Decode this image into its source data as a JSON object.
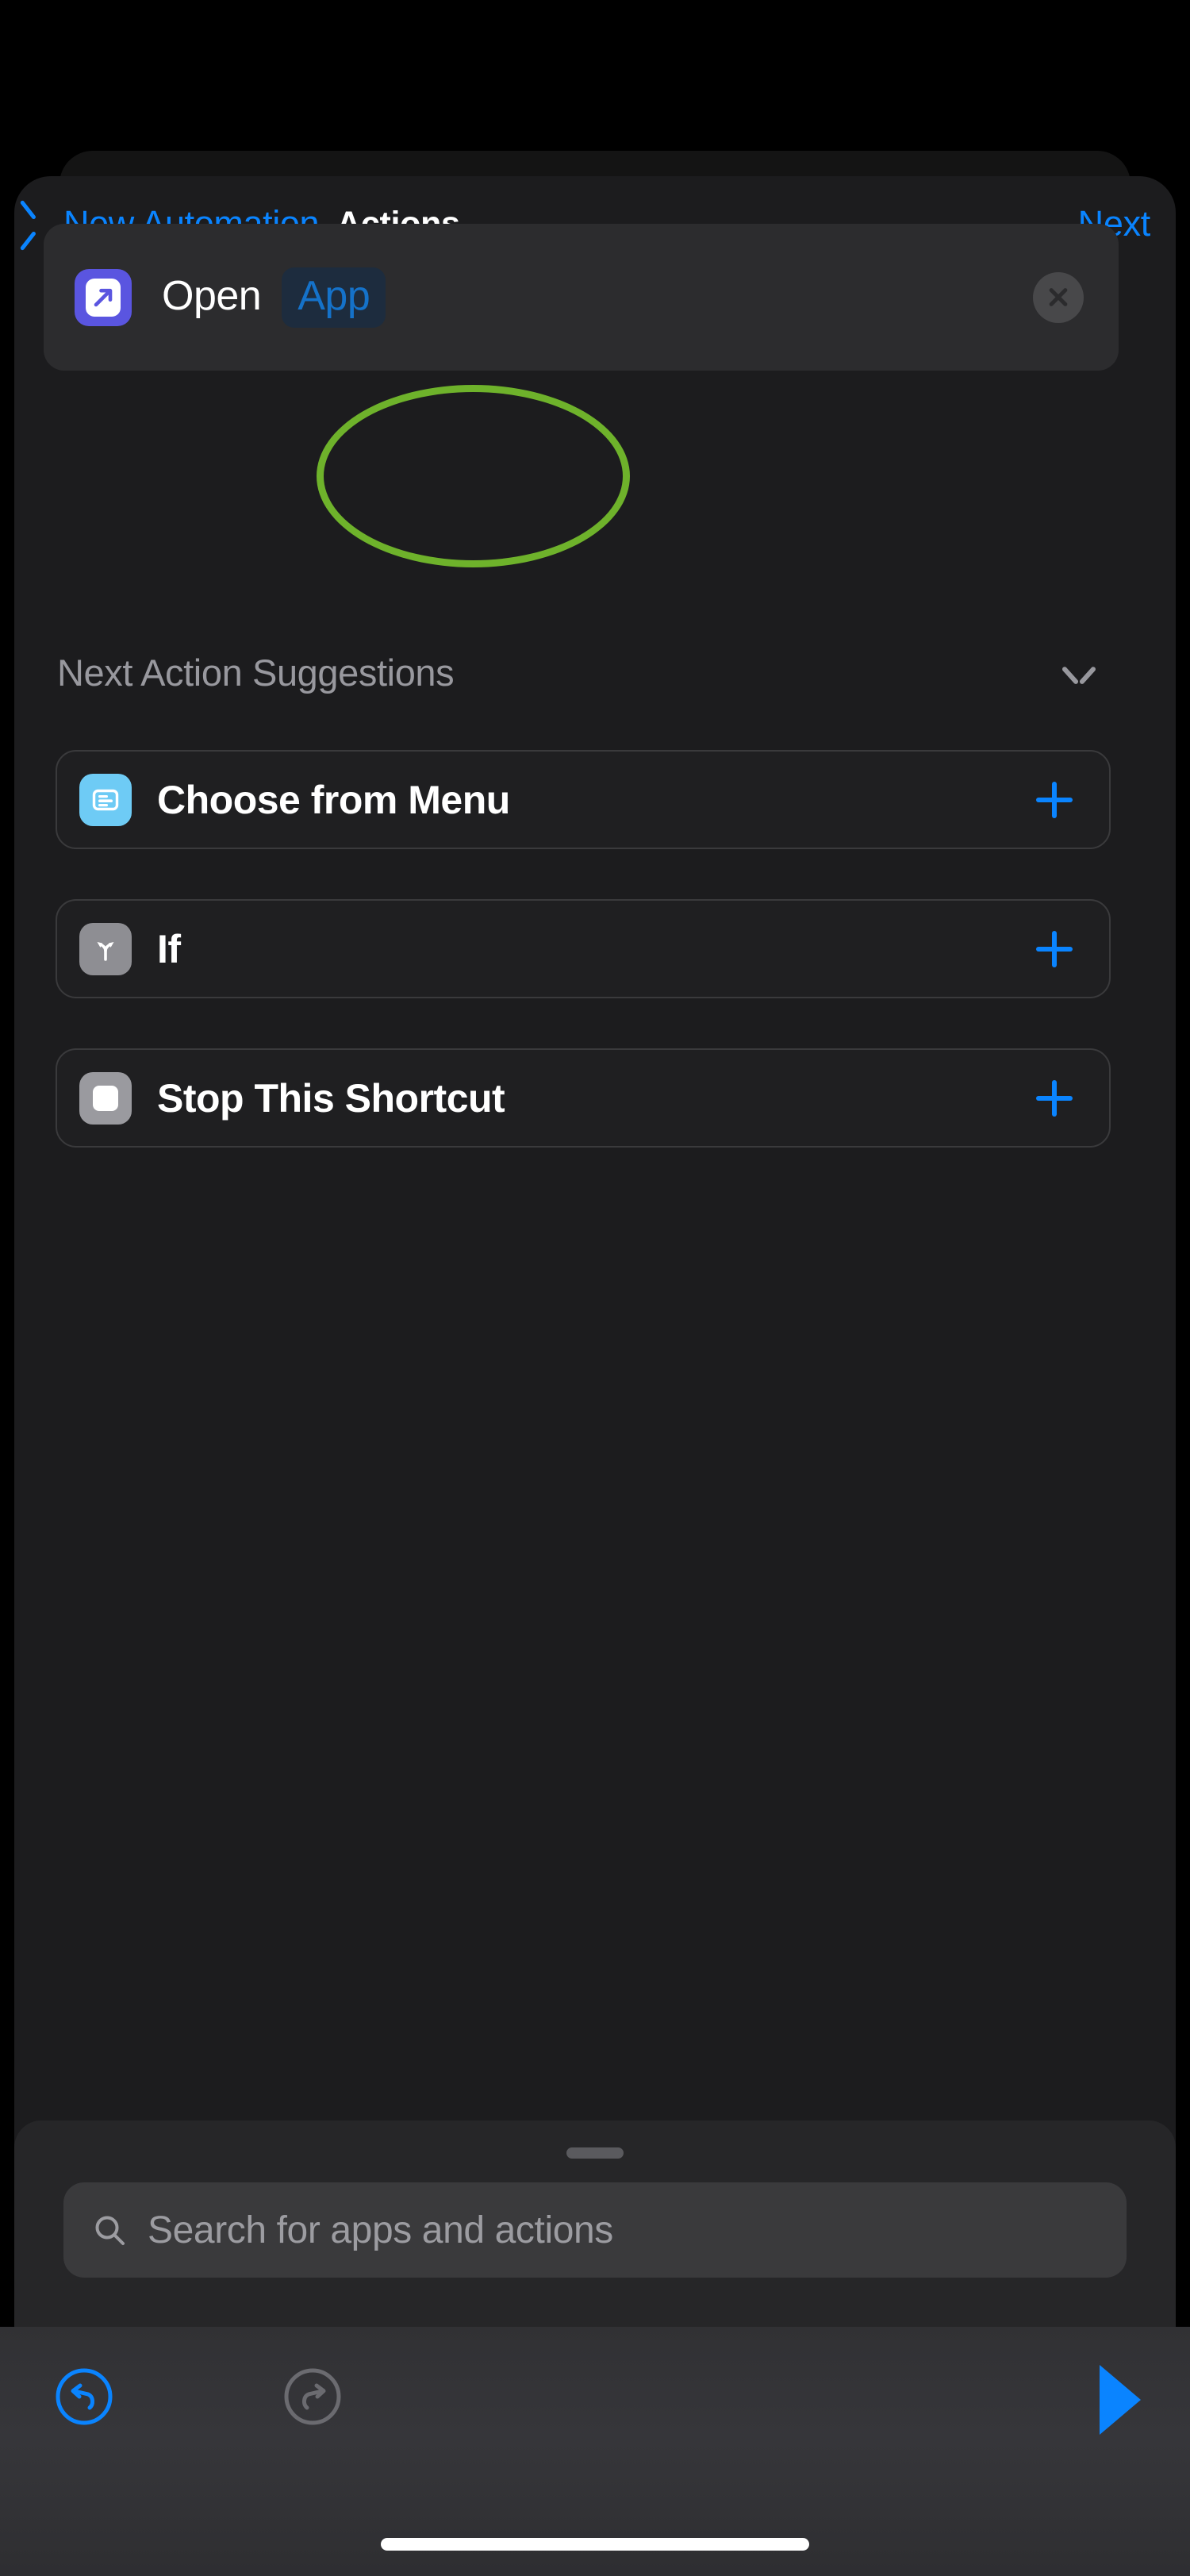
{
  "app": {
    "name": "Shortcuts",
    "theme": "dark"
  },
  "colors": {
    "accent_blue": "#0a84ff",
    "token_blue": "#1572c9",
    "token_background": "#1d2c3e",
    "annotation_green": "#6eb22b",
    "open_app_icon_purple": "#5a55e0",
    "menu_icon_blue": "#6ecbf5",
    "gray_icon": "#8e8e93",
    "sheet_background": "#1c1c1e",
    "card_background": "#2c2c2e",
    "secondary_text": "#98989e"
  },
  "navbar": {
    "back_icon": "chevron-left-icon",
    "back_label": "New Automation",
    "title": "Actions",
    "next_label": "Next"
  },
  "action_card": {
    "icon": "open-app-icon",
    "icon_glyph": "arrow-up-right-icon",
    "label": "Open",
    "token_label": "App",
    "close_icon": "close-circle-icon"
  },
  "annotation": {
    "shape": "ellipse",
    "color": "#6eb22b",
    "targets": "App"
  },
  "suggestions": {
    "header": "Next Action Suggestions",
    "collapse_icon": "chevron-down-icon",
    "items": [
      {
        "label": "Choose from Menu",
        "icon": "menu-list-icon",
        "icon_color": "#6ecbf5",
        "add_icon": "plus-icon"
      },
      {
        "label": "If",
        "icon": "branch-fork-icon",
        "icon_color": "#8e8e93",
        "add_icon": "plus-icon"
      },
      {
        "label": "Stop This Shortcut",
        "icon": "stop-square-icon",
        "icon_color": "#9a9a9f",
        "add_icon": "plus-icon"
      }
    ]
  },
  "search_sheet": {
    "grabber": "sheet-grabber",
    "search_icon": "search-icon",
    "placeholder": "Search for apps and actions",
    "value": ""
  },
  "toolbar": {
    "undo_icon": "undo-icon",
    "undo_enabled": "true",
    "redo_icon": "redo-icon",
    "redo_enabled": "false",
    "run_icon": "play-icon"
  },
  "system": {
    "home_indicator": "home-indicator"
  }
}
